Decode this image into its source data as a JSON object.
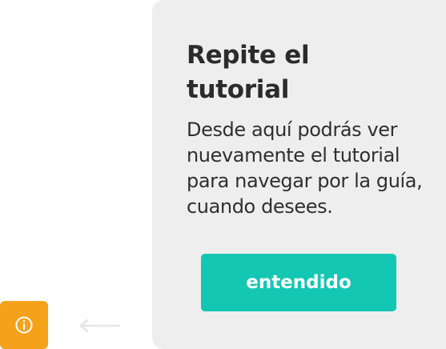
{
  "sidebar": {
    "info_icon": "info-circle-icon",
    "accent_color": "#f5a21b"
  },
  "nav": {
    "back_icon": "arrow-left-icon"
  },
  "tutorial_card": {
    "title": "Repite el tutorial",
    "body": "Desde aquí podrás ver nuevamente el tutorial para navegar por la guía, cuando desees.",
    "button_label": "entendido",
    "button_color": "#13c7b2",
    "background_color": "#eeeeee"
  }
}
